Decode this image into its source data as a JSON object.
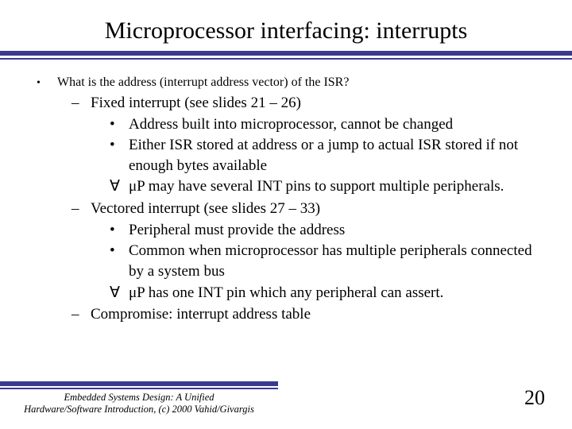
{
  "title": "Microprocessor interfacing: interrupts",
  "bullets": {
    "q": "What is the address (interrupt address vector) of the ISR?",
    "fixed": "Fixed interrupt (see slides 21 – 26)",
    "fixed_a": "Address built into microprocessor, cannot be changed",
    "fixed_b": "Either ISR stored at address or a jump to actual ISR stored if not enough bytes available",
    "fixed_c": "μP may have several INT pins to support multiple peripherals.",
    "vectored": "Vectored interrupt (see slides 27 – 33)",
    "vec_a": "Peripheral must provide the address",
    "vec_b": "Common when microprocessor has multiple peripherals connected by a system bus",
    "vec_c": "μP has one INT pin which any peripheral can assert.",
    "compromise": "Compromise: interrupt address table"
  },
  "footer": {
    "line1": "Embedded Systems Design: A Unified",
    "line2": "Hardware/Software Introduction, (c) 2000 Vahid/Givargis"
  },
  "page_number": "20"
}
